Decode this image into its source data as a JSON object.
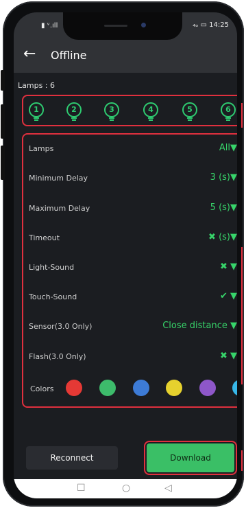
{
  "status_bar": {
    "left": "▮ ᵛ.ıll",
    "right": "₄ₒ ▭ 14:25"
  },
  "app_bar": {
    "title": "Offline",
    "back_icon": "arrow-left-icon"
  },
  "lamps_label": "Lamps : 6",
  "lamps": [
    "1",
    "2",
    "3",
    "4",
    "5",
    "6"
  ],
  "settings": [
    {
      "label": "Lamps",
      "value": "All▼"
    },
    {
      "label": "Minimum Delay",
      "value": "3 (s)▼"
    },
    {
      "label": "Maximum Delay",
      "value": "5 (s)▼"
    },
    {
      "label": "Timeout",
      "value": "✖ (s)▼"
    },
    {
      "label": "Light-Sound",
      "value": "✖ ▼"
    },
    {
      "label": "Touch-Sound",
      "value": "✔ ▼"
    },
    {
      "label": "Sensor(3.0 Only)",
      "value": "Close distance ▼"
    },
    {
      "label": "Flash(3.0 Only)",
      "value": "✖ ▼"
    }
  ],
  "colors_label": "Colors",
  "colors": [
    "#e53935",
    "#3dbb6b",
    "#3d7bd6",
    "#e6d12e",
    "#8e57c9",
    "#37b7e8"
  ],
  "buttons": {
    "reconnect": "Reconnect",
    "download": "Download"
  },
  "nav": {
    "square": "☐",
    "circle": "○",
    "back": "◁"
  },
  "accent_color": "#37d46a",
  "highlight_color": "#e0303e"
}
